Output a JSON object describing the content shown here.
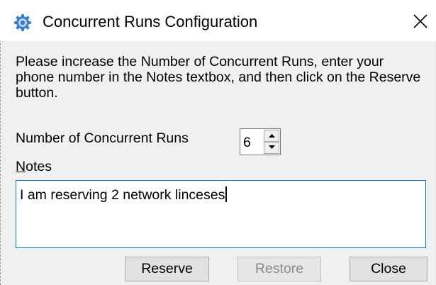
{
  "window": {
    "title": "Concurrent Runs Configuration",
    "title_icon": "gear-icon",
    "close_glyph": "✕"
  },
  "instructions": "Please increase the Number of Concurrent Runs, enter your phone number in the Notes textbox, and then click on the Reserve button.",
  "runs": {
    "label": "Number of Concurrent Runs",
    "value": "6"
  },
  "notes": {
    "label_accel": "N",
    "label_rest": "otes",
    "value": "I am reserving 2 network linceses"
  },
  "buttons": {
    "reserve": "Reserve",
    "restore": "Restore",
    "restore_enabled": false,
    "close": "Close"
  },
  "colors": {
    "focus_border": "#0078d7",
    "icon_blue": "#3c7fc4",
    "disabled_text": "#8a8a8a"
  }
}
